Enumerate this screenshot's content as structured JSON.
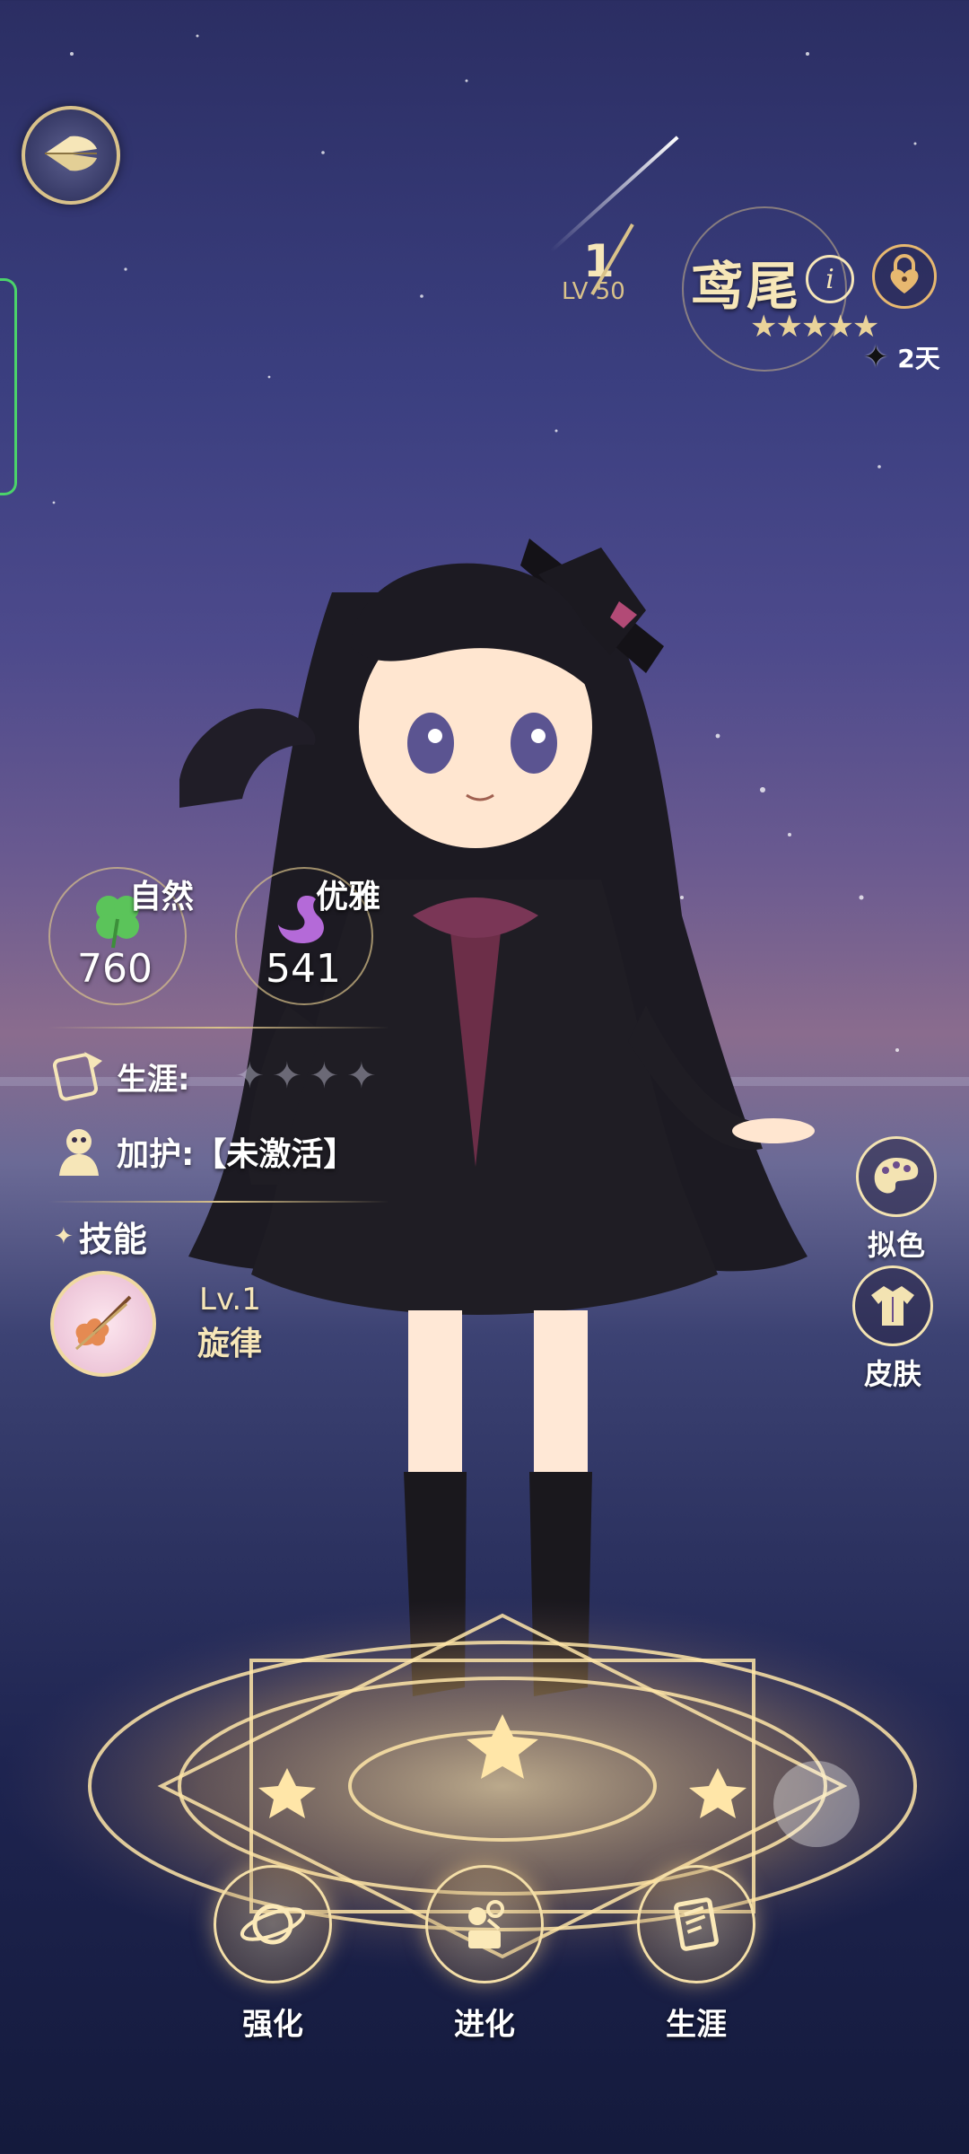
{
  "colors": {
    "accent_gold": "#f6e6b8",
    "clover_green": "#5bc45a",
    "swan_purple": "#b46ad8",
    "side_tab_green": "#4bd36a"
  },
  "header": {
    "back_icon": "wings-back-icon",
    "level_current": "1",
    "level_max": "LV 50",
    "character_name": "鸢尾",
    "info_label": "i",
    "star_count": 5,
    "stars": "★★★★★",
    "days_icon": "sparkle-icon",
    "days_text": "2天"
  },
  "stats": [
    {
      "name": "自然",
      "value": "760",
      "icon": "clover-icon"
    },
    {
      "name": "优雅",
      "value": "541",
      "icon": "swan-icon"
    }
  ],
  "career": {
    "label": "生涯:",
    "icon": "career-icon",
    "rating_stars": "✦✦✦✦"
  },
  "blessing": {
    "label": "加护:【未激活】",
    "icon": "blessing-icon"
  },
  "skills": {
    "title": "技能",
    "skill_level": "Lv.1",
    "skill_name": "旋律",
    "skill_icon": "violin-icon"
  },
  "side_buttons": [
    {
      "label": "拟色",
      "icon": "palette-icon"
    },
    {
      "label": "皮肤",
      "icon": "outfit-icon"
    }
  ],
  "bottom_buttons": [
    {
      "label": "强化",
      "icon": "planet-icon"
    },
    {
      "label": "进化",
      "icon": "evolve-icon"
    },
    {
      "label": "生涯",
      "icon": "book-icon"
    }
  ]
}
